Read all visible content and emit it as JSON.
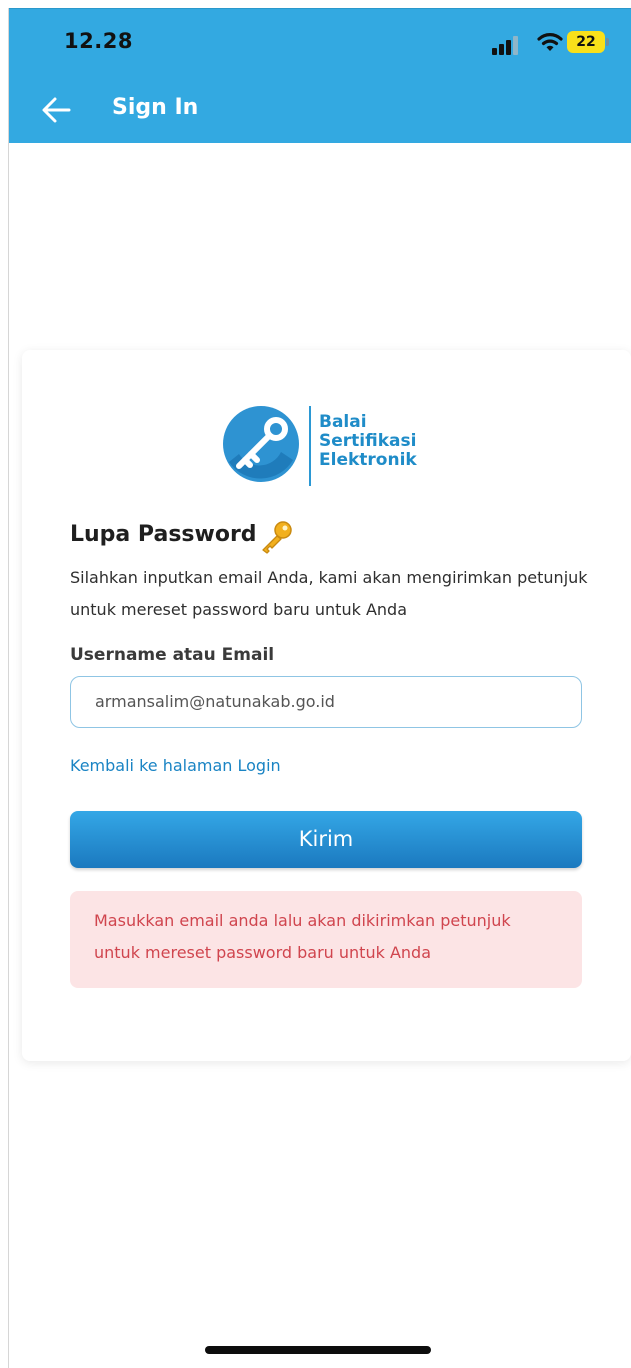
{
  "status_bar": {
    "time": "12.28",
    "battery": "22"
  },
  "nav": {
    "title": "Sign In"
  },
  "logo": {
    "line1": "Balai",
    "line2": "Sertifikasi",
    "line3": "Elektronik"
  },
  "form": {
    "heading": "Lupa Password",
    "description": "Silahkan inputkan email Anda, kami akan mengirimkan petunjuk untuk mereset password baru untuk Anda",
    "field_label": "Username atau Email",
    "email_value": "armansalim@natunakab.go.id",
    "back_link": "Kembali ke halaman Login",
    "submit_label": "Kirim",
    "alert_text": "Masukkan email anda lalu akan dikirimkan petunjuk untuk mereset password baru untuk Anda"
  },
  "colors": {
    "header_blue": "#33a9e1",
    "button_blue": "#1b79bf",
    "link_blue": "#1a84c4",
    "alert_bg": "#fce4e5",
    "alert_text": "#d0454e",
    "battery_yellow": "#f9e01a"
  },
  "icons": {
    "back": "arrow-left-icon",
    "signal": "cellular-signal-icon",
    "wifi": "wifi-icon",
    "key": "key-icon"
  }
}
